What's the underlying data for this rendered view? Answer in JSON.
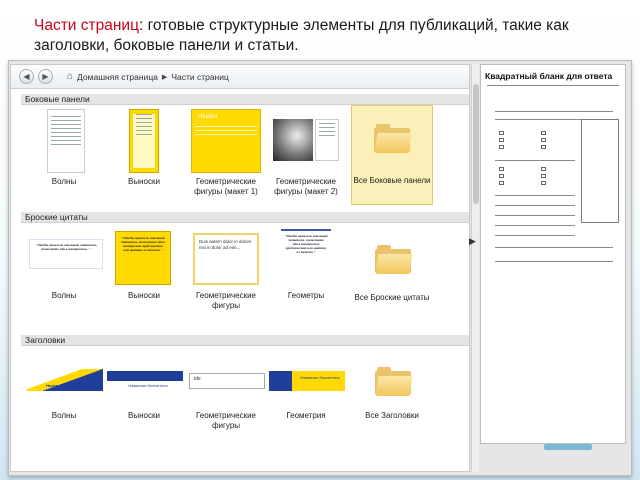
{
  "caption": {
    "highlight": "Части страниц",
    "rest": ": готовые структурные элементы для публикаций, такие как заголовки, боковые панели и статьи."
  },
  "nav": {
    "back_icon": "◀",
    "forward_icon": "▶",
    "home_icon": "⌂",
    "separator": "▶",
    "crumbs": [
      "Домашняя страница",
      "Части страниц"
    ]
  },
  "sections": {
    "sidebars": "Боковые панели",
    "quotes": "Броские цитаты",
    "headings": "Заголовки"
  },
  "sidebars": [
    {
      "label": "Волны"
    },
    {
      "label": "Выноски"
    },
    {
      "label": "Геометрические фигуры (макет 1)",
      "thumb_title": "Header"
    },
    {
      "label": "Геометрические фигуры (макет 2)"
    },
    {
      "label": "Все Боковые панели"
    }
  ],
  "quotes": [
    {
      "label": "Волны",
      "text": "\"Чтобы привлечь внимание читателя, поместите здесь интересное...\""
    },
    {
      "label": "Выноски",
      "text": "\"Чтобы привлечь внимание читателя, поместите здесь интересное предложение или цитату из текста.\""
    },
    {
      "label": "Геометрические фигуры",
      "text": "Duis autem dolor in dolore nisl in dolor ad eim..."
    },
    {
      "label": "Геометры",
      "text": "\"Чтобы привлечь внимание читателя, поместите здесь интересное предложение или цитату из текста.\""
    },
    {
      "label": "Все Броские цитаты"
    }
  ],
  "headings": [
    {
      "label": "Волны",
      "text": "Название бюллетеня"
    },
    {
      "label": "Выноски",
      "text": "Название бюллетеня"
    },
    {
      "label": "Геометрические фигуры",
      "text": "ide"
    },
    {
      "label": "Геометрия",
      "text": "Название бюллетеня"
    },
    {
      "label": "Все Заголовки"
    }
  ],
  "preview": {
    "title": "Квадратный бланк для ответа"
  },
  "colors": {
    "caption_highlight": "#d0021b",
    "selected_bg": "#fbefba",
    "callout_yellow": "#ffd900",
    "heading_blue": "#1f3f9a"
  }
}
